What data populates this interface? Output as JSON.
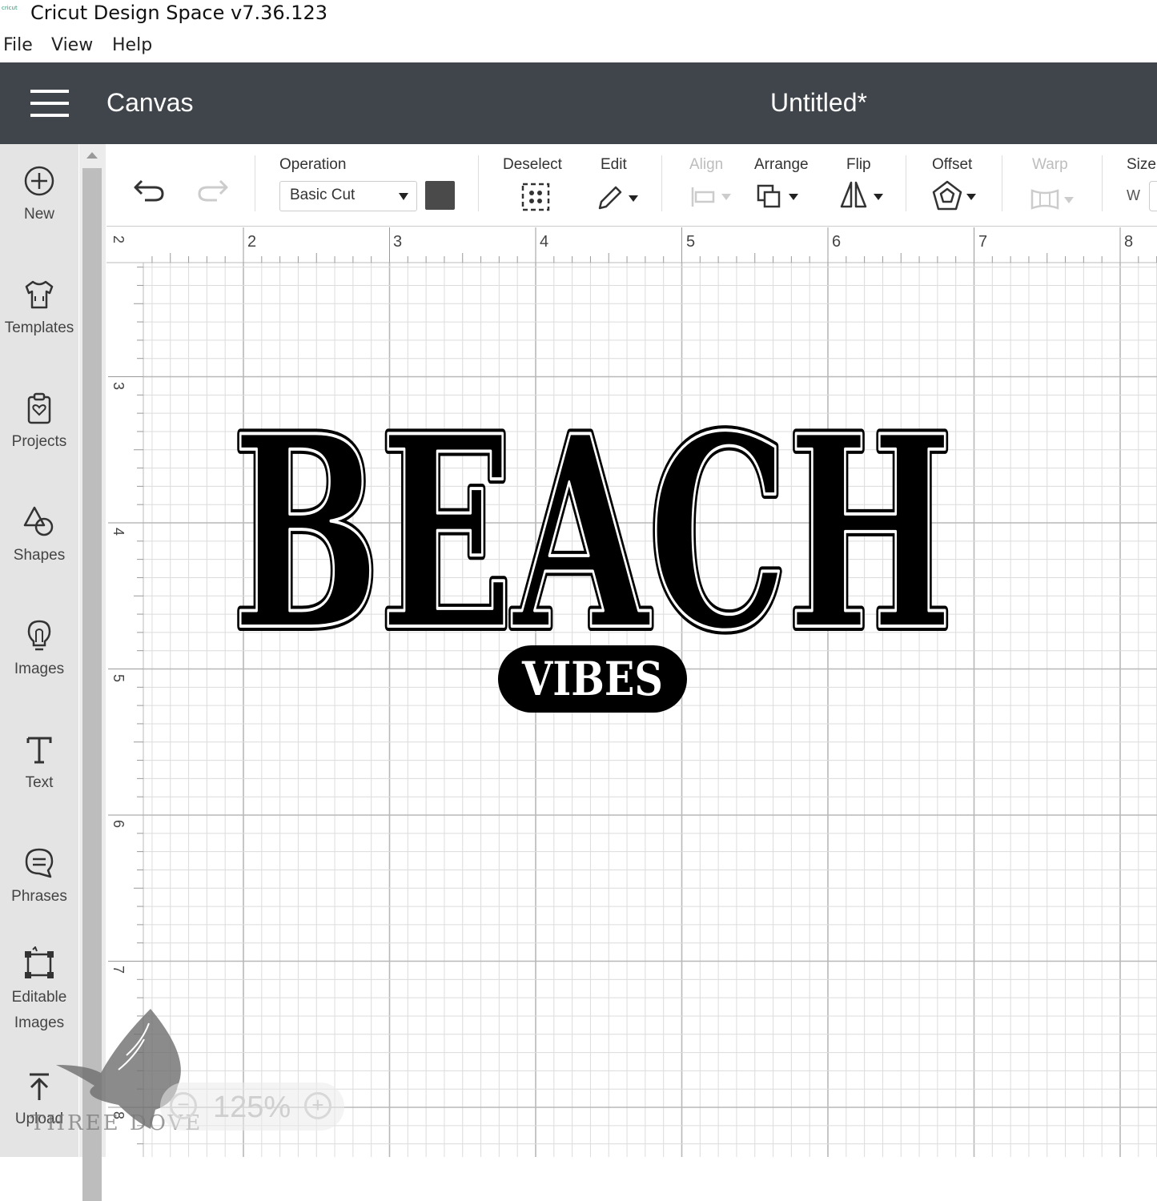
{
  "window": {
    "logo_text": "cricut",
    "title": "Cricut Design Space  v7.36.123"
  },
  "menu": [
    "File",
    "View",
    "Help"
  ],
  "header": {
    "page_title": "Canvas",
    "document_title": "Untitled*"
  },
  "sidebar": {
    "items": [
      {
        "label": "New",
        "icon": "plus-circle-icon"
      },
      {
        "label": "Templates",
        "icon": "tshirt-icon"
      },
      {
        "label": "Projects",
        "icon": "project-icon"
      },
      {
        "label": "Shapes",
        "icon": "shapes-icon"
      },
      {
        "label": "Images",
        "icon": "lightbulb-icon"
      },
      {
        "label": "Text",
        "icon": "text-icon"
      },
      {
        "label": "Phrases",
        "icon": "speech-bubble-icon"
      },
      {
        "label": "Editable Images",
        "label_line1": "Editable",
        "label_line2": "Images",
        "icon": "editable-images-icon"
      },
      {
        "label": "Upload",
        "icon": "upload-icon"
      }
    ]
  },
  "toolbar": {
    "operation_label": "Operation",
    "operation_value": "Basic Cut",
    "operation_color": "#4a4a4a",
    "deselect_label": "Deselect",
    "edit_label": "Edit",
    "align_label": "Align",
    "arrange_label": "Arrange",
    "flip_label": "Flip",
    "offset_label": "Offset",
    "warp_label": "Warp",
    "size_label": "Size",
    "size_w_label": "W"
  },
  "rulers": {
    "horizontal": [
      "2",
      "3",
      "4",
      "5",
      "6",
      "7",
      "8"
    ],
    "vertical": [
      "2",
      "3",
      "4",
      "5",
      "6",
      "7",
      "8"
    ]
  },
  "design": {
    "main_word": "BEACH",
    "sub_word": "VIBES",
    "fill_color": "#000000"
  },
  "zoom": {
    "minus": "−",
    "level": "125%",
    "plus": "+"
  },
  "watermark": {
    "text": "THREE DOVE"
  }
}
